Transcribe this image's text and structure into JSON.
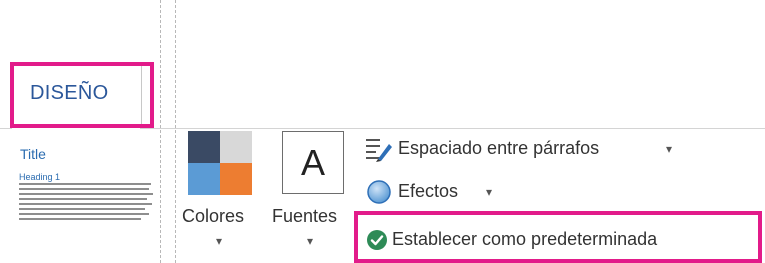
{
  "tab": {
    "label": "DISEÑO"
  },
  "theme_thumbnail": {
    "title": "Title",
    "heading": "Heading 1"
  },
  "colors_button": {
    "label": "Colores",
    "dropdown": "▾",
    "swatches": [
      "#3a4a64",
      "#d8d8d8",
      "#5b9bd5",
      "#ed7d31"
    ]
  },
  "fonts_button": {
    "label": "Fuentes",
    "preview": "A",
    "dropdown": "▾"
  },
  "commands": {
    "spacing": {
      "label": "Espaciado entre párrafos",
      "dropdown": "▾"
    },
    "effects": {
      "label": "Efectos",
      "dropdown": "▾"
    },
    "set_default": {
      "label": "Establecer como predeterminada"
    }
  },
  "colors": {
    "highlight": "#e21b8a",
    "accent_blue": "#2b579a",
    "check_green": "#2e8b57"
  }
}
